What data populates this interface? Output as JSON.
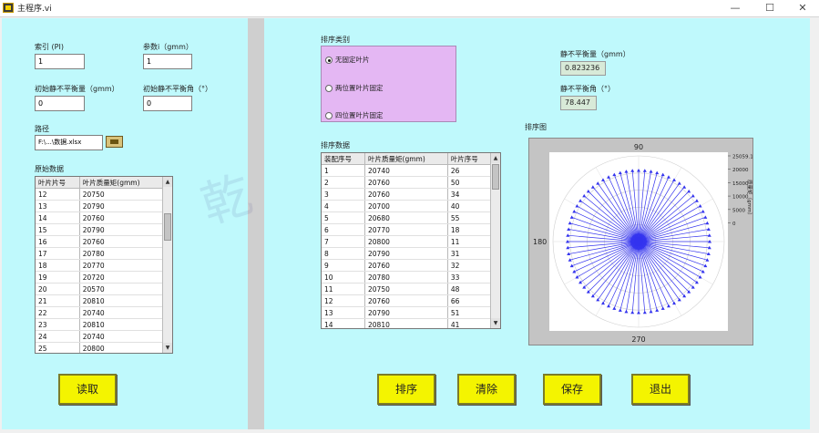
{
  "window": {
    "title": "主程序.vi",
    "minimize": "—",
    "maximize": "☐",
    "close": "✕"
  },
  "left": {
    "index_label": "索引 (PI)",
    "index_value": "1",
    "param_label": "参数i（gmm）",
    "param_value": "1",
    "init_unbalance_label": "初始静不平衡量（gmm）",
    "init_unbalance_value": "0",
    "init_angle_label": "初始静不平衡角（°）",
    "init_angle_value": "0",
    "path_label": "路径",
    "path_value": "F:\\...\\数据.xlsx",
    "raw_label": "原始数据",
    "raw_table": {
      "headers": [
        "叶片片号",
        "叶片质量矩(gmm)"
      ],
      "rows": [
        [
          "12",
          "20750"
        ],
        [
          "13",
          "20790"
        ],
        [
          "14",
          "20760"
        ],
        [
          "15",
          "20790"
        ],
        [
          "16",
          "20760"
        ],
        [
          "17",
          "20780"
        ],
        [
          "18",
          "20770"
        ],
        [
          "19",
          "20720"
        ],
        [
          "20",
          "20570"
        ],
        [
          "21",
          "20810"
        ],
        [
          "22",
          "20740"
        ],
        [
          "23",
          "20810"
        ],
        [
          "24",
          "20740"
        ],
        [
          "25",
          "20800"
        ]
      ]
    },
    "read_button": "读取"
  },
  "right": {
    "sort_type_label": "排序类别",
    "sort_options": [
      "无固定叶片",
      "两位置叶片固定",
      "四位置叶片固定"
    ],
    "sort_selected_index": 0,
    "static_unbalance_label": "静不平衡量（gmm）",
    "static_unbalance_value": "0.823236",
    "static_angle_label": "静不平衡角（°）",
    "static_angle_value": "78.447",
    "sort_data_label": "排序数据",
    "sort_table": {
      "headers": [
        "装配序号",
        "叶片质量矩(gmm)",
        "叶片序号"
      ],
      "rows": [
        [
          "1",
          "20740",
          "26"
        ],
        [
          "2",
          "20760",
          "50"
        ],
        [
          "3",
          "20760",
          "34"
        ],
        [
          "4",
          "20700",
          "40"
        ],
        [
          "5",
          "20680",
          "55"
        ],
        [
          "6",
          "20770",
          "18"
        ],
        [
          "7",
          "20800",
          "11"
        ],
        [
          "8",
          "20790",
          "31"
        ],
        [
          "9",
          "20760",
          "32"
        ],
        [
          "10",
          "20780",
          "33"
        ],
        [
          "11",
          "20750",
          "48"
        ],
        [
          "12",
          "20760",
          "66"
        ],
        [
          "13",
          "20790",
          "51"
        ],
        [
          "14",
          "20810",
          "41"
        ]
      ]
    },
    "chart_label": "排序图",
    "buttons": {
      "sort": "排序",
      "clear": "清除",
      "save": "保存",
      "exit": "退出"
    }
  },
  "chart_data": {
    "type": "polar",
    "angle_labels": [
      "90",
      "180",
      "270"
    ],
    "radial_ticks": [
      "25059.13",
      "20000",
      "15000",
      "10000",
      "5000",
      "0"
    ],
    "radial_axis_label": "质量矩（gmm）",
    "rmax": 25059.13,
    "spoke_count": 72,
    "spoke_value": 20800,
    "color": "#3333ee"
  },
  "watermark": "乾"
}
